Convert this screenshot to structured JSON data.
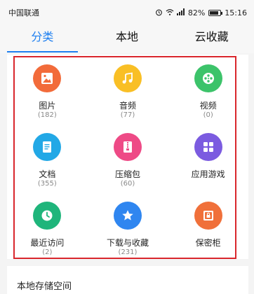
{
  "status": {
    "carrier": "中国联通",
    "battery": "82%",
    "battery_level": 0.82,
    "time": "15:16",
    "icons": [
      "alarm-icon",
      "wifi-icon",
      "signal-icon",
      "battery-icon"
    ]
  },
  "tabs": [
    {
      "label": "分类",
      "active": true
    },
    {
      "label": "本地",
      "active": false
    },
    {
      "label": "云收藏",
      "active": false
    }
  ],
  "categories": [
    {
      "label": "图片",
      "count": "(182)",
      "icon": "image-icon",
      "color": "#f26b3a"
    },
    {
      "label": "音频",
      "count": "(77)",
      "icon": "music-icon",
      "color": "#f9bf25"
    },
    {
      "label": "视频",
      "count": "(0)",
      "icon": "video-icon",
      "color": "#3cc36a"
    },
    {
      "label": "文档",
      "count": "(355)",
      "icon": "document-icon",
      "color": "#22a8e6"
    },
    {
      "label": "压缩包",
      "count": "(60)",
      "icon": "zip-icon",
      "color": "#ee4a86"
    },
    {
      "label": "应用游戏",
      "count": "",
      "icon": "apps-icon",
      "color": "#7b5be0"
    },
    {
      "label": "最近访问",
      "count": "(2)",
      "icon": "clock-icon",
      "color": "#1fb57b"
    },
    {
      "label": "下载与收藏",
      "count": "(231)",
      "icon": "star-icon",
      "color": "#2f86f0"
    },
    {
      "label": "保密柜",
      "count": "",
      "icon": "safe-icon",
      "color": "#f0703a"
    }
  ],
  "bottom": {
    "title": "本地存储空间"
  }
}
